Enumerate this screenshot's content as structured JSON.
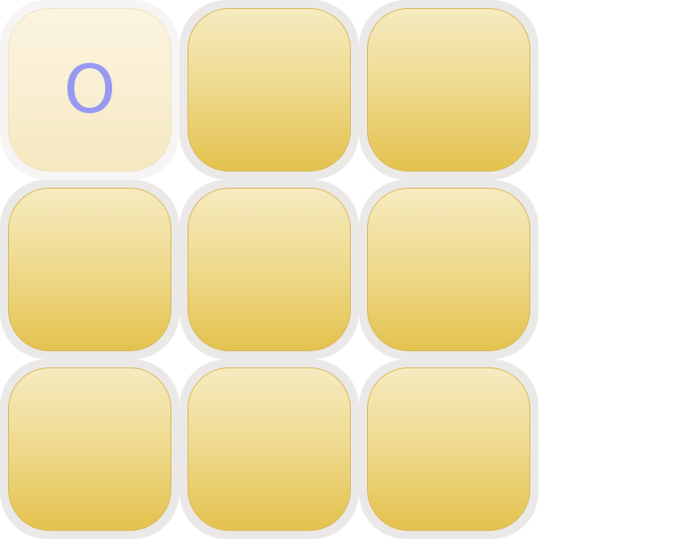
{
  "board": {
    "cells": [
      {
        "mark": "O",
        "state": "active"
      },
      {
        "mark": "",
        "state": "empty"
      },
      {
        "mark": "",
        "state": "empty"
      },
      {
        "mark": "",
        "state": "empty"
      },
      {
        "mark": "",
        "state": "empty"
      },
      {
        "mark": "",
        "state": "empty"
      },
      {
        "mark": "",
        "state": "empty"
      },
      {
        "mark": "",
        "state": "empty"
      },
      {
        "mark": "",
        "state": "empty"
      }
    ]
  },
  "colors": {
    "mark_o": "#9999f2",
    "tile_top": "#f6ebc0",
    "tile_bottom": "#e4c24e",
    "cell_frame": "#ebe9e8"
  }
}
